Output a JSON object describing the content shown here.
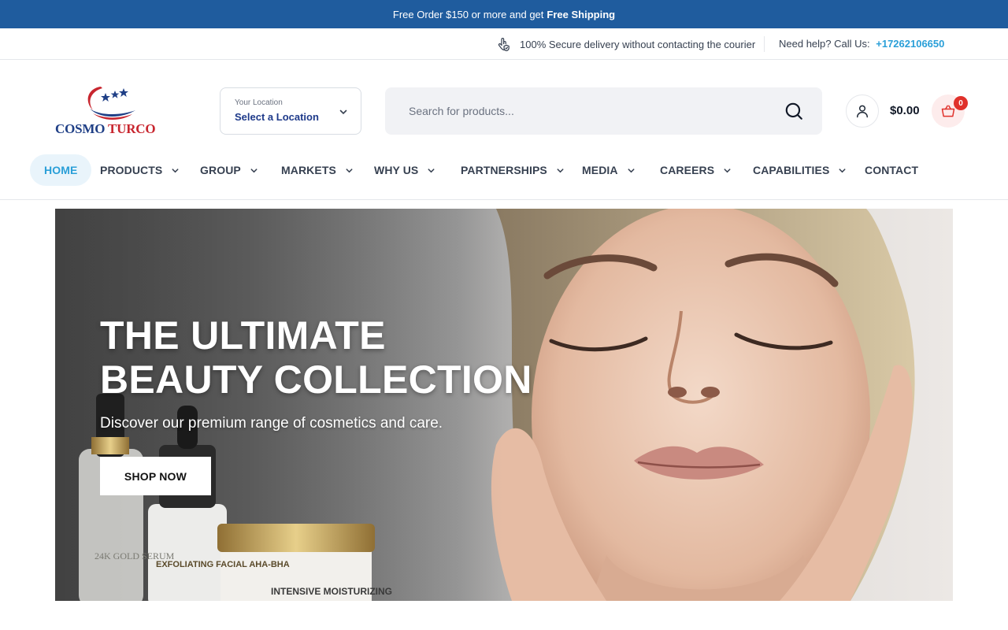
{
  "announcement": {
    "text": "Free Order $150 or more and get",
    "highlight": "Free Shipping"
  },
  "topbar": {
    "secure_text": "100% Secure delivery without contacting the courier",
    "help_label": "Need help? Call Us:",
    "phone": "+17262106650"
  },
  "logo": {
    "part1": "COSMO",
    "part2": "TURCO"
  },
  "location": {
    "label": "Your Location",
    "value": "Select a Location"
  },
  "search": {
    "placeholder": "Search for products..."
  },
  "cart": {
    "total": "$0.00",
    "count": "0"
  },
  "nav": {
    "items": [
      {
        "label": "HOME"
      },
      {
        "label": "PRODUCTS"
      },
      {
        "label": "GROUP"
      },
      {
        "label": "MARKETS"
      },
      {
        "label": "WHY US"
      },
      {
        "label": "PARTNERSHIPS"
      },
      {
        "label": "MEDIA"
      },
      {
        "label": "CAREERS"
      },
      {
        "label": "CAPABILITIES"
      },
      {
        "label": "CONTACT"
      }
    ]
  },
  "hero": {
    "title_line1": "THE ULTIMATE",
    "title_line2": "BEAUTY COLLECTION",
    "subtitle": "Discover our premium range of cosmetics and care.",
    "cta": "SHOP NOW",
    "bottle1_text": "24K GOLD SERUM",
    "bottle2_text": "EXFOLIATING FACIAL AHA-BHA",
    "jar_text": "INTENSIVE MOISTURIZING"
  },
  "colors": {
    "brand_blue": "#1f5c9e",
    "accent": "#2a9fd8",
    "badge": "#e0312b"
  },
  "icons": [
    "hand-shield-icon",
    "chevron-down-icon",
    "search-icon",
    "user-icon",
    "basket-icon"
  ]
}
